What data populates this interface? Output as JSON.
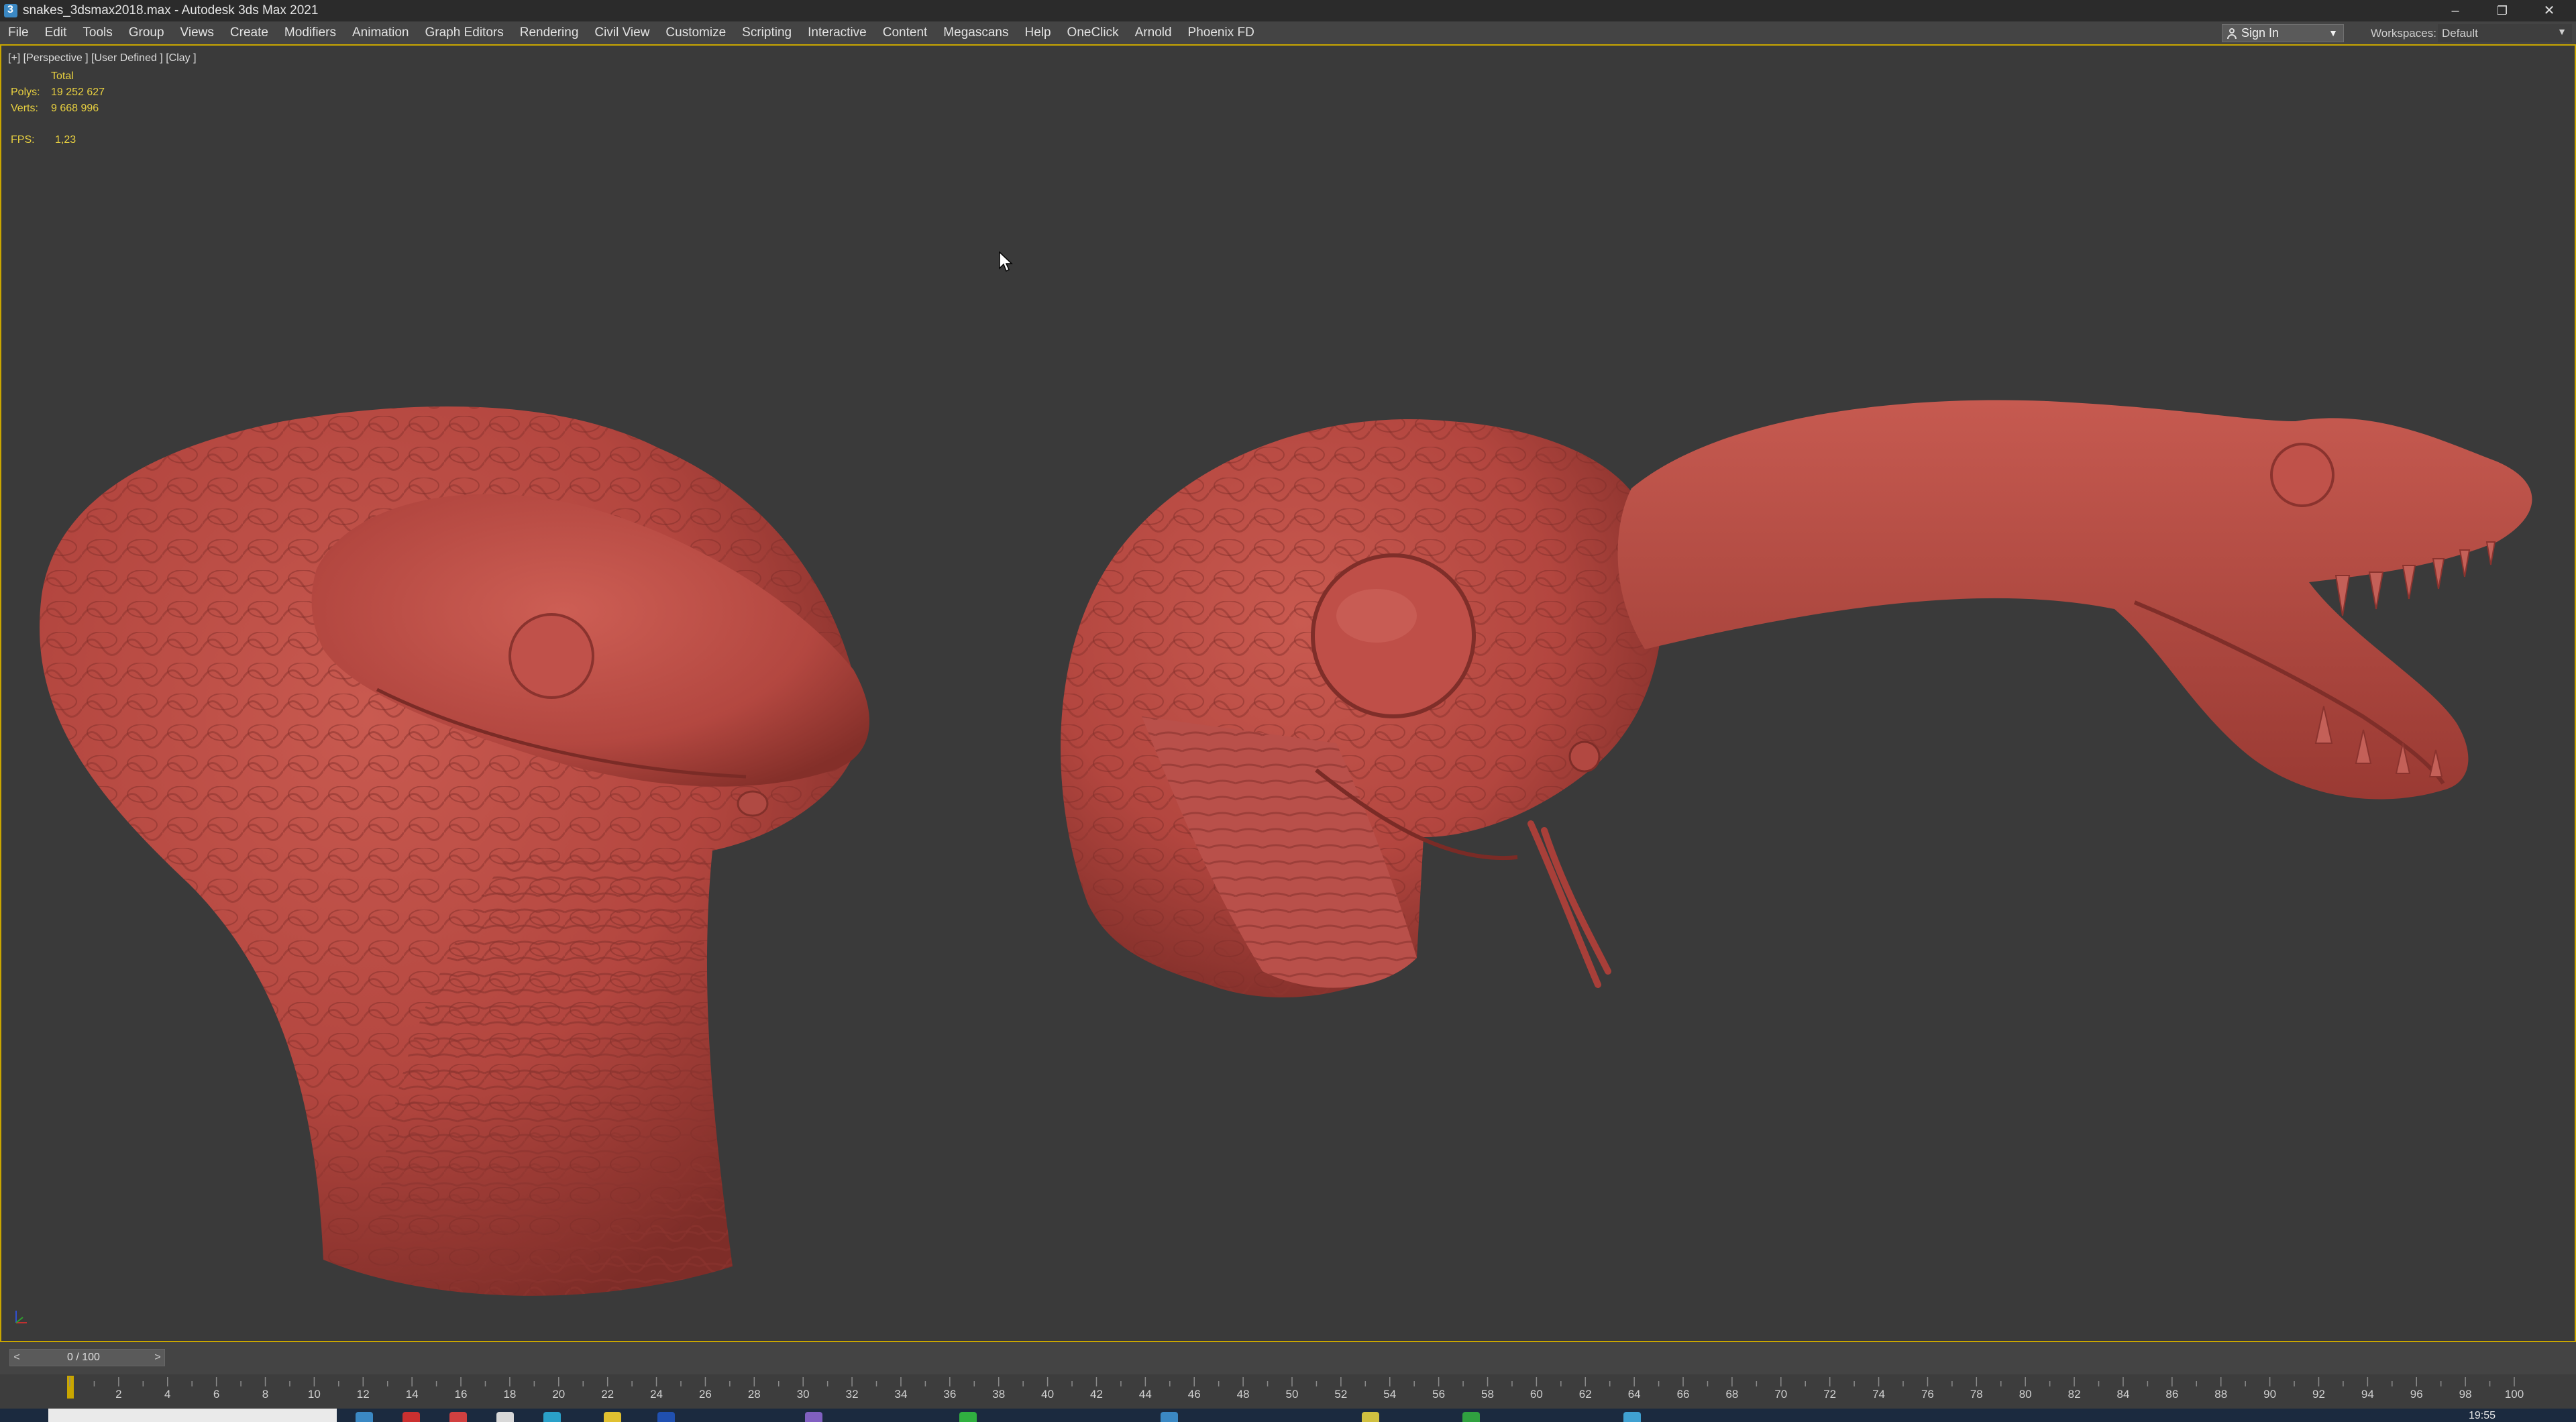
{
  "window": {
    "title": "snakes_3dsmax2018.max - Autodesk 3ds Max 2021",
    "minimize": "–",
    "restore": "❐",
    "close": "✕"
  },
  "menu": [
    "File",
    "Edit",
    "Tools",
    "Group",
    "Views",
    "Create",
    "Modifiers",
    "Animation",
    "Graph Editors",
    "Rendering",
    "Civil View",
    "Customize",
    "Scripting",
    "Interactive",
    "Content",
    "Megascans",
    "Help",
    "OneClick",
    "Arnold",
    "Phoenix FD"
  ],
  "account": {
    "sign_in": "Sign In"
  },
  "workspaces": {
    "label": "Workspaces:",
    "value": "Default"
  },
  "viewport": {
    "label": "[+] [Perspective ] [User Defined ] [Clay ]",
    "stats": {
      "total_label": "Total",
      "polys_label": "Polys:",
      "polys": "19 252 627",
      "verts_label": "Verts:",
      "verts": "9 668 996",
      "fps_label": "FPS:",
      "fps": "1,23"
    }
  },
  "timeslider": {
    "frame": "0 / 100",
    "prev": "<",
    "next": ">"
  },
  "trackbar": {
    "ticks": [
      "2",
      "4",
      "6",
      "8",
      "10",
      "12",
      "14",
      "16",
      "18",
      "20",
      "22",
      "24",
      "26",
      "28",
      "30",
      "32",
      "34",
      "36",
      "38",
      "40",
      "42",
      "44",
      "46",
      "48",
      "50",
      "52",
      "54",
      "56",
      "58",
      "60",
      "62",
      "64",
      "66",
      "68",
      "70",
      "72",
      "74",
      "76",
      "78",
      "80",
      "82",
      "84",
      "86",
      "88",
      "90",
      "92",
      "94",
      "96",
      "98",
      "100"
    ]
  },
  "taskbar": {
    "clock": "19:55"
  },
  "colors": {
    "clay": "#b5463f",
    "viewport_bg": "#3a3a3a",
    "active_border": "#c9a600",
    "stats_text": "#e8d040"
  }
}
